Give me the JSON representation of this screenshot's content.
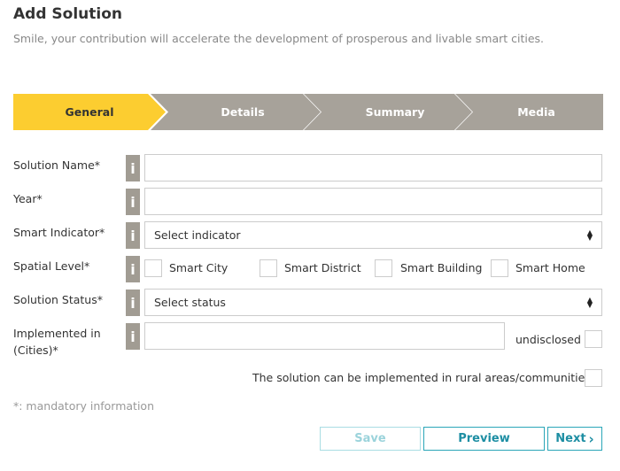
{
  "header": {
    "title": "Add Solution",
    "subtitle": "Smile, your contribution will accelerate the development of prosperous and livable smart cities."
  },
  "steps": [
    {
      "label": "General",
      "active": true
    },
    {
      "label": "Details",
      "active": false
    },
    {
      "label": "Summary",
      "active": false
    },
    {
      "label": "Media",
      "active": false
    }
  ],
  "colors": {
    "step_active": "#fccd30",
    "step_inactive": "#a7a29a",
    "info_badge": "#a19c93",
    "button_accent": "#2aa6b8"
  },
  "form": {
    "info_icon": "i",
    "solution_name": {
      "label": "Solution Name*",
      "value": ""
    },
    "year": {
      "label": "Year*",
      "value": ""
    },
    "smart_indicator": {
      "label": "Smart Indicator*",
      "selected": "Select indicator"
    },
    "spatial_level": {
      "label": "Spatial Level*",
      "options": [
        "Smart City",
        "Smart District",
        "Smart Building",
        "Smart Home"
      ]
    },
    "solution_status": {
      "label": "Solution Status*",
      "selected": "Select status"
    },
    "implemented_in": {
      "label_line1": "Implemented in",
      "label_line2": "(Cities)*",
      "value": ""
    },
    "undisclosed_label": "undisclosed",
    "rural_label": "The solution can be implemented in rural areas/communities.",
    "mandatory_note": "*: mandatory information"
  },
  "buttons": {
    "save": "Save",
    "preview": "Preview",
    "next": "Next",
    "next_icon": "›"
  }
}
